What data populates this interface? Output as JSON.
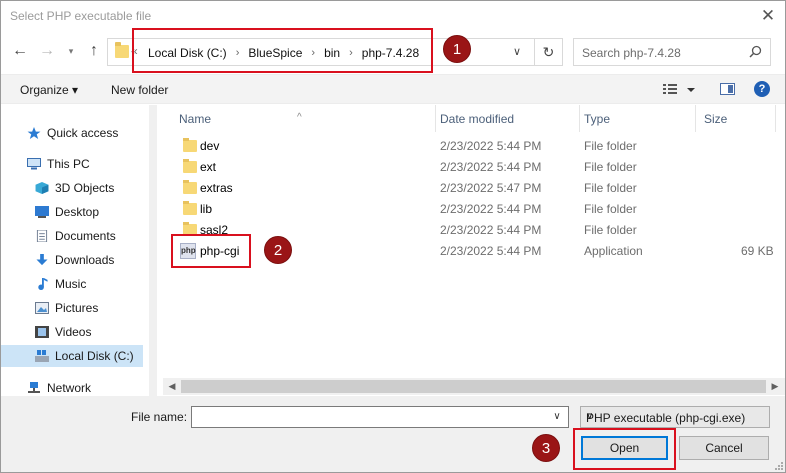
{
  "window": {
    "title": "Select PHP executable file"
  },
  "address": {
    "crumbs": [
      "Local Disk (C:)",
      "BlueSpice",
      "bin",
      "php-7.4.28"
    ]
  },
  "search": {
    "placeholder": "Search php-7.4.28"
  },
  "toolbar": {
    "organize": "Organize ▾",
    "new_folder": "New folder",
    "help": "?"
  },
  "sidebar": {
    "items": [
      {
        "label": "Quick access",
        "icon": "star-icon"
      },
      {
        "label": "This PC",
        "icon": "computer-icon"
      },
      {
        "label": "3D Objects",
        "icon": "cube-icon"
      },
      {
        "label": "Desktop",
        "icon": "desktop-icon"
      },
      {
        "label": "Documents",
        "icon": "document-icon"
      },
      {
        "label": "Downloads",
        "icon": "download-icon"
      },
      {
        "label": "Music",
        "icon": "music-icon"
      },
      {
        "label": "Pictures",
        "icon": "picture-icon"
      },
      {
        "label": "Videos",
        "icon": "video-icon"
      },
      {
        "label": "Local Disk (C:)",
        "icon": "drive-icon"
      },
      {
        "label": "Network",
        "icon": "network-icon"
      }
    ]
  },
  "columns": {
    "name": "Name",
    "date": "Date modified",
    "type": "Type",
    "size": "Size"
  },
  "files": [
    {
      "name": "dev",
      "date": "2/23/2022 5:44 PM",
      "type": "File folder",
      "size": ""
    },
    {
      "name": "ext",
      "date": "2/23/2022 5:44 PM",
      "type": "File folder",
      "size": ""
    },
    {
      "name": "extras",
      "date": "2/23/2022 5:47 PM",
      "type": "File folder",
      "size": ""
    },
    {
      "name": "lib",
      "date": "2/23/2022 5:44 PM",
      "type": "File folder",
      "size": ""
    },
    {
      "name": "sasl2",
      "date": "2/23/2022 5:44 PM",
      "type": "File folder",
      "size": ""
    },
    {
      "name": "php-cgi",
      "date": "2/23/2022 5:44 PM",
      "type": "Application",
      "size": "69 KB"
    }
  ],
  "bottom": {
    "file_name_label": "File name:",
    "file_name_value": "",
    "file_type": "PHP executable (php-cgi.exe)",
    "open": "Open",
    "cancel": "Cancel"
  },
  "annotations": [
    "1",
    "2",
    "3"
  ],
  "colors": {
    "accent": "#0078d7",
    "annotation_red": "#d9101e",
    "annotation_badge": "#9a1516",
    "selected": "#cce4f7"
  }
}
